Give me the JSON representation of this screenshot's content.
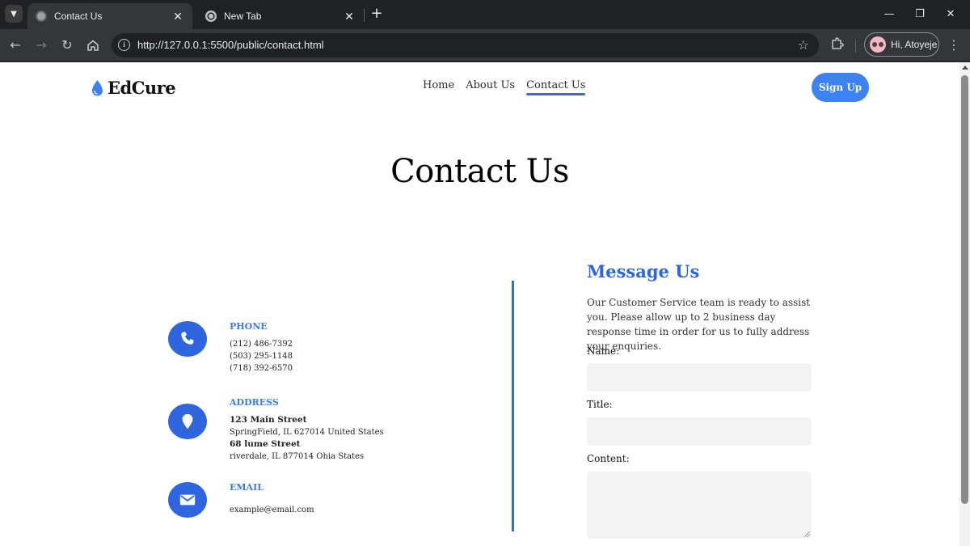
{
  "browser": {
    "tabs": [
      {
        "title": "Contact Us",
        "active": true
      },
      {
        "title": "New Tab",
        "active": false
      }
    ],
    "url": "http://127.0.0.1:5500/public/contact.html",
    "profile_label": "Hi, Atoyeje",
    "icons": {
      "tab_search": "chevron-down-icon",
      "close": "close-icon",
      "new_tab": "plus-icon",
      "back": "arrow-left-icon",
      "forward": "arrow-right-icon",
      "reload": "reload-icon",
      "home": "home-icon",
      "site_info": "info-icon",
      "bookmark": "star-icon",
      "extensions": "puzzle-icon",
      "menu": "kebab-menu-icon",
      "minimize": "minimize-icon",
      "restore": "restore-icon",
      "window_close": "close-icon"
    }
  },
  "site": {
    "brand": "EdCure",
    "nav": [
      {
        "label": "Home",
        "active": false
      },
      {
        "label": "About Us",
        "active": false
      },
      {
        "label": "Contact Us",
        "active": true
      }
    ],
    "signup_label": "Sign Up",
    "page_title": "Contact Us",
    "contact": {
      "phone": {
        "label": "PHONE",
        "lines": [
          "(212) 486-7392",
          "(503) 295-1148",
          "(718) 392-6570"
        ],
        "icon": "phone-icon"
      },
      "address": {
        "label": "ADDRESS",
        "lines": [
          "123 Main Street",
          "SpringField, IL 627014 United States",
          "68 lume Street",
          "riverdale, IL 877014 Ohia States"
        ],
        "icon": "location-pin-icon"
      },
      "email": {
        "label": "EMAIL",
        "lines": [
          "example@email.com"
        ],
        "icon": "envelope-icon"
      }
    },
    "message": {
      "title": "Message Us",
      "description": "Our Customer Service team is ready to assist you. Please allow up to 2 business day response time in order for us to fully address your enquiries.",
      "fields": [
        {
          "label": "Name:",
          "value": ""
        },
        {
          "label": "Title:",
          "value": ""
        },
        {
          "label": "Content:",
          "value": ""
        }
      ]
    },
    "colors": {
      "accent": "#2f66e0",
      "button": "#3c82f0",
      "label": "#3b7de0",
      "field_bg": "#f3f3f3"
    }
  }
}
